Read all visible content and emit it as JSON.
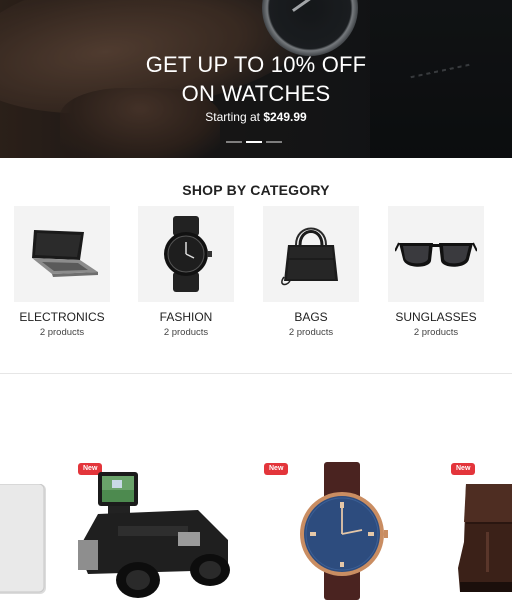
{
  "hero": {
    "title_line1": "GET UP TO 10% OFF",
    "title_line2": "ON WATCHES",
    "subtitle_prefix": "Starting at",
    "subtitle_price": "$249.99",
    "slides": 3,
    "active_slide": 2
  },
  "categories": {
    "title": "SHOP BY CATEGORY",
    "items": [
      {
        "name": "ELECTRONICS",
        "count": "2 products",
        "icon": "laptop-image"
      },
      {
        "name": "FASHION",
        "count": "2 products",
        "icon": "watch-image"
      },
      {
        "name": "BAGS",
        "count": "2 products",
        "icon": "handbag-image"
      },
      {
        "name": "SUNGLASSES",
        "count": "2 products",
        "icon": "sunglasses-image"
      }
    ]
  },
  "products": {
    "items": [
      {
        "badge": "",
        "icon": "laptop-image"
      },
      {
        "badge": "New",
        "icon": "camera-binoculars-image"
      },
      {
        "badge": "New",
        "icon": "wristwatch-image"
      },
      {
        "badge": "New",
        "icon": "boot-image"
      }
    ]
  },
  "colors": {
    "badge": "#e3353b",
    "watch_dial": "#2d4c7e",
    "strap": "#4a2320"
  }
}
